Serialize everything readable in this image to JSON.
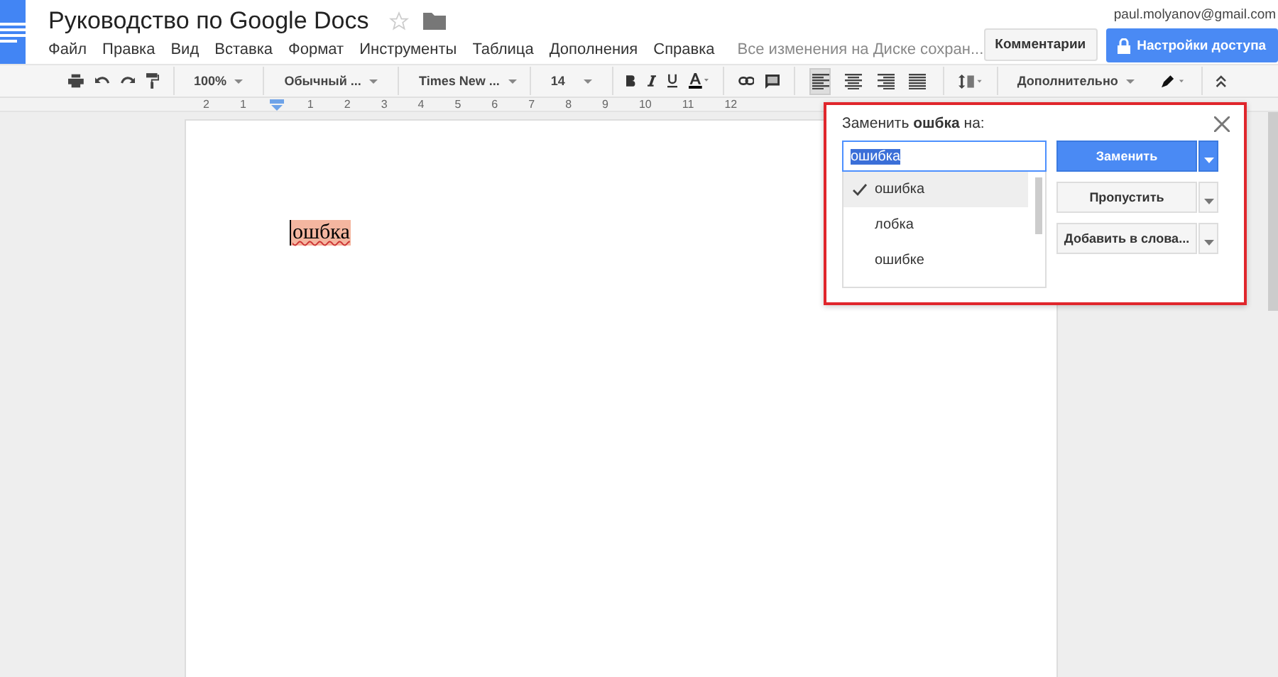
{
  "document": {
    "title": "Руководство по Google Docs",
    "starred": false,
    "save_status": "Все изменения на Диске сохран..."
  },
  "menu": [
    "Файл",
    "Правка",
    "Вид",
    "Вставка",
    "Формат",
    "Инструменты",
    "Таблица",
    "Дополнения",
    "Справка"
  ],
  "account": {
    "email": "paul.molyanov@gmail.com"
  },
  "buttons": {
    "comments": "Комментарии",
    "share": "Настройки доступа"
  },
  "toolbar": {
    "zoom": "100%",
    "style": "Обычный ...",
    "font": "Times New ...",
    "size": "14",
    "more": "Дополнительно",
    "alignments": [
      {
        "kind": "left",
        "selected": true
      },
      {
        "kind": "center",
        "selected": false
      },
      {
        "kind": "right",
        "selected": false
      },
      {
        "kind": "justify",
        "selected": false
      }
    ]
  },
  "ruler": [
    "2",
    "1",
    "1",
    "2",
    "3",
    "4",
    "5",
    "6",
    "7",
    "8",
    "9",
    "10",
    "11",
    "12"
  ],
  "page": {
    "word": "ошбка"
  },
  "spell_dialog": {
    "title": "Заменить **ошбка** на:",
    "value": "ошибка",
    "suggestions": [
      {
        "text": "ошибка",
        "selected": true
      },
      {
        "text": "лобка",
        "selected": false
      },
      {
        "text": "ошибке",
        "selected": false
      }
    ],
    "actions": [
      "Заменить",
      "Пропустить",
      "Добавить в слова..."
    ]
  }
}
